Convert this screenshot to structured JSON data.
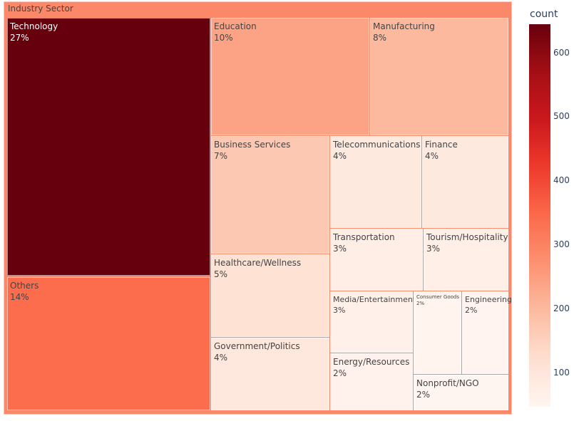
{
  "chart_data": {
    "type": "treemap",
    "root_label": "Industry Sector",
    "colorbar": {
      "title": "count",
      "colorscale": "Reds",
      "range": [
        46,
        644
      ],
      "ticks": [
        100,
        200,
        300,
        400,
        500,
        600
      ],
      "tick_labels": [
        "100",
        "200",
        "300",
        "400",
        "500",
        "600"
      ]
    },
    "items": [
      {
        "label": "Technology",
        "percent": "27%",
        "count": 644
      },
      {
        "label": "Others",
        "percent": "14%",
        "count": 340
      },
      {
        "label": "Education",
        "percent": "10%",
        "count": 240
      },
      {
        "label": "Manufacturing",
        "percent": "8%",
        "count": 200
      },
      {
        "label": "Business Services",
        "percent": "7%",
        "count": 170
      },
      {
        "label": "Healthcare/Wellness",
        "percent": "5%",
        "count": 115
      },
      {
        "label": "Government/Politics",
        "percent": "4%",
        "count": 95
      },
      {
        "label": "Telecommunications",
        "percent": "4%",
        "count": 90
      },
      {
        "label": "Finance",
        "percent": "4%",
        "count": 88
      },
      {
        "label": "Transportation",
        "percent": "3%",
        "count": 72
      },
      {
        "label": "Tourism/Hospitality",
        "percent": "3%",
        "count": 68
      },
      {
        "label": "Media/Entertainment",
        "percent": "3%",
        "count": 62
      },
      {
        "label": "Energy/Resources",
        "percent": "2%",
        "count": 55
      },
      {
        "label": "Consumer Goods",
        "percent": "2%",
        "count": 50
      },
      {
        "label": "Engineering",
        "percent": "2%",
        "count": 48
      },
      {
        "label": "Nonprofit/NGO",
        "percent": "2%",
        "count": 46
      }
    ]
  }
}
